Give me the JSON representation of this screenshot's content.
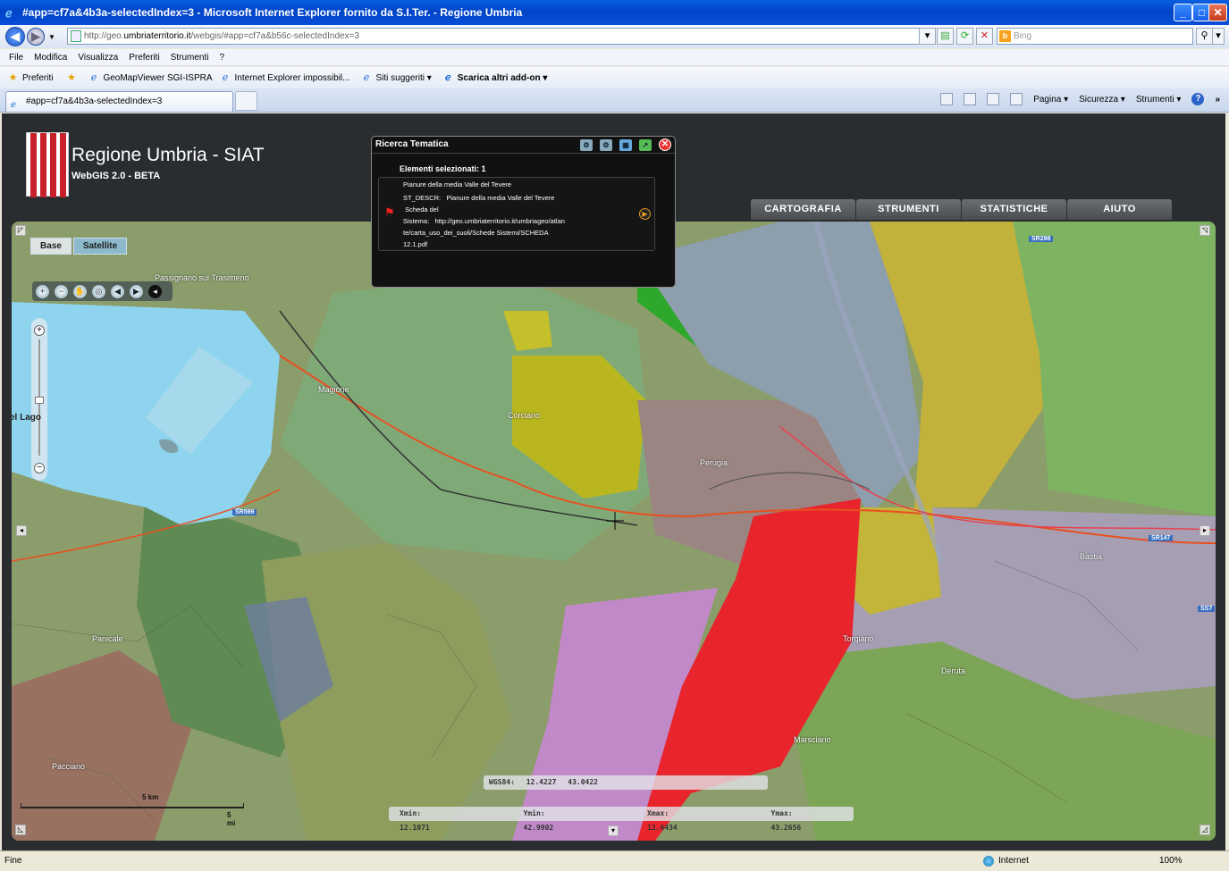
{
  "window": {
    "title": "#app=cf7a&4b3a-selectedIndex=3 - Microsoft Internet Explorer fornito da S.I.Ter. - Regione Umbria"
  },
  "address": {
    "prefix": "http://geo.",
    "domain": "umbriaterritorio.it",
    "path": "/webgis/#app=cf7a&b56c-selectedIndex=3"
  },
  "search": {
    "placeholder": "Bing"
  },
  "menubar": [
    "File",
    "Modifica",
    "Visualizza",
    "Preferiti",
    "Strumenti",
    "?"
  ],
  "favorites": {
    "label": "Preferiti",
    "items": [
      "GeoMapViewer SGI-ISPRA",
      "Internet Explorer impossibil...",
      "Siti suggeriti ▾",
      "Scarica altri add-on ▾"
    ]
  },
  "tab": {
    "label": "#app=cf7a&4b3a-selectedIndex=3"
  },
  "commands": [
    "Pagina ▾",
    "Sicurezza ▾",
    "Strumenti ▾"
  ],
  "site": {
    "title": "Regione Umbria - SIAT",
    "subtitle": "WebGIS 2.0 - BETA",
    "menu": [
      "CARTOGRAFIA",
      "STRUMENTI",
      "STATISTICHE",
      "AIUTO"
    ]
  },
  "map": {
    "toggles": [
      "Base",
      "Satellite"
    ],
    "coords": {
      "label": "WGS84:",
      "lon": "12.4227",
      "lat": "43.0422"
    },
    "bbox": {
      "xmin_label": "Xmin:",
      "xmin": "12.1071",
      "ymin_label": "Ymin:",
      "ymin": "42.9902",
      "xmax_label": "Xmax:",
      "xmax": "12.6434",
      "ymax_label": "Ymax:",
      "ymax": "43.2656"
    },
    "scale": {
      "km": "5 km",
      "mi": "5 mi"
    },
    "place_labels": [
      "Perugia",
      "Corciano",
      "Magione",
      "Bastia",
      "Deruta",
      "Torgiano",
      "Panicale",
      "Passignano sul Trasimeno",
      "Marsciano",
      "Pacciano"
    ],
    "road_labels": [
      "SR298",
      "SR599",
      "SR147",
      "SS7"
    ],
    "lake_label": "el Lago",
    "colors": {
      "red": "#e8242c",
      "yellow": "#c9bc2c",
      "green": "#2ea82a",
      "purple": "#c189c8",
      "lake": "#8fd4ef"
    }
  },
  "popup": {
    "title": "Ricerca Tematica",
    "count": "Elementi selezionati: 1",
    "heading": "Pianure della media Valle del Tevere",
    "field1_label": "ST_DESCR:",
    "field1_value": "Pianure della media Valle del Tevere",
    "field2_label": "Scheda del",
    "field2_label2": "Sistema:",
    "field2_line1": "http://geo.umbriaterritorio.it/umbriageo/atlan",
    "field2_line2": "te/carta_uso_dei_suoli/Schede Sistemi/SCHEDA",
    "field2_line3": "12.1.pdf"
  },
  "status": {
    "left": "Fine",
    "zone": "Internet",
    "zoom": "100%"
  }
}
